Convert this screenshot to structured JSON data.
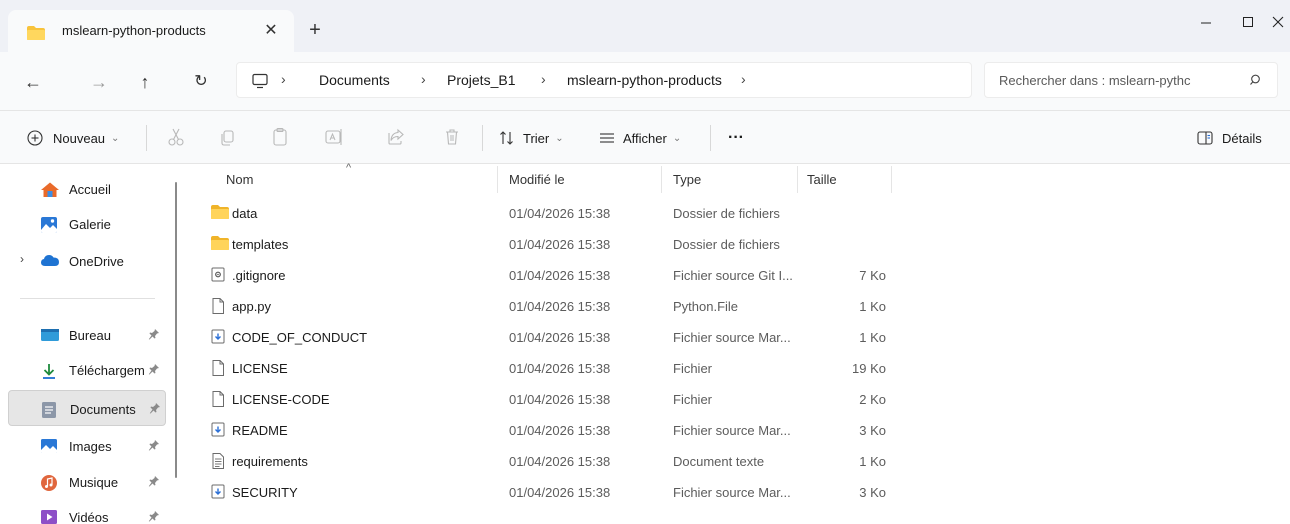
{
  "tab": {
    "title": "mslearn-python-products",
    "close": "✕",
    "new_tab": "+"
  },
  "window_controls": {
    "minimize": "—",
    "maximize": "☐",
    "close": "✕"
  },
  "nav": {
    "back": "←",
    "forward": "→",
    "up": "↑",
    "refresh": "↻"
  },
  "breadcrumb": {
    "separator": "›",
    "items": [
      "Documents",
      "Projets_B1",
      "mslearn-python-products"
    ]
  },
  "search": {
    "placeholder": "Rechercher dans : mslearn-pythc"
  },
  "commandbar": {
    "new_label": "Nouveau",
    "sort_label": "Trier",
    "view_label": "Afficher",
    "more_label": "···",
    "details_label": "Détails",
    "chevron": "⌄"
  },
  "sidebar": {
    "items": [
      {
        "label": "Accueil",
        "icon": "home-icon"
      },
      {
        "label": "Galerie",
        "icon": "gallery-icon"
      },
      {
        "label": "OneDrive",
        "icon": "cloud-icon"
      },
      {
        "label": "Bureau",
        "icon": "desktop-icon"
      },
      {
        "label": "Téléchargem",
        "icon": "download-icon"
      },
      {
        "label": "Documents",
        "icon": "documents-icon"
      },
      {
        "label": "Images",
        "icon": "images-icon"
      },
      {
        "label": "Musique",
        "icon": "music-icon"
      },
      {
        "label": "Vidéos",
        "icon": "videos-icon"
      }
    ],
    "expander": "›",
    "pin": "📌"
  },
  "columns": {
    "name": "Nom",
    "modified": "Modifié le",
    "type": "Type",
    "size": "Taille",
    "sort_indicator": "^"
  },
  "files": [
    {
      "name": "data",
      "modified": "01/04/2026 15:38",
      "type": "Dossier de fichiers",
      "size": "",
      "icon": "folder-icon"
    },
    {
      "name": "templates",
      "modified": "01/04/2026 15:38",
      "type": "Dossier de fichiers",
      "size": "",
      "icon": "folder-icon"
    },
    {
      "name": ".gitignore",
      "modified": "01/04/2026 15:38",
      "type": "Fichier source Git I...",
      "size": "7 Ko",
      "icon": "git-file-icon"
    },
    {
      "name": "app.py",
      "modified": "01/04/2026 15:38",
      "type": "Python.File",
      "size": "1 Ko",
      "icon": "file-icon"
    },
    {
      "name": "CODE_OF_CONDUCT",
      "modified": "01/04/2026 15:38",
      "type": "Fichier source Mar...",
      "size": "1 Ko",
      "icon": "markdown-file-icon"
    },
    {
      "name": "LICENSE",
      "modified": "01/04/2026 15:38",
      "type": "Fichier",
      "size": "19 Ko",
      "icon": "file-icon"
    },
    {
      "name": "LICENSE-CODE",
      "modified": "01/04/2026 15:38",
      "type": "Fichier",
      "size": "2 Ko",
      "icon": "file-icon"
    },
    {
      "name": "README",
      "modified": "01/04/2026 15:38",
      "type": "Fichier source Mar...",
      "size": "3 Ko",
      "icon": "markdown-file-icon"
    },
    {
      "name": "requirements",
      "modified": "01/04/2026 15:38",
      "type": "Document texte",
      "size": "1 Ko",
      "icon": "text-file-icon"
    },
    {
      "name": "SECURITY",
      "modified": "01/04/2026 15:38",
      "type": "Fichier source Mar...",
      "size": "3 Ko",
      "icon": "markdown-file-icon"
    }
  ]
}
